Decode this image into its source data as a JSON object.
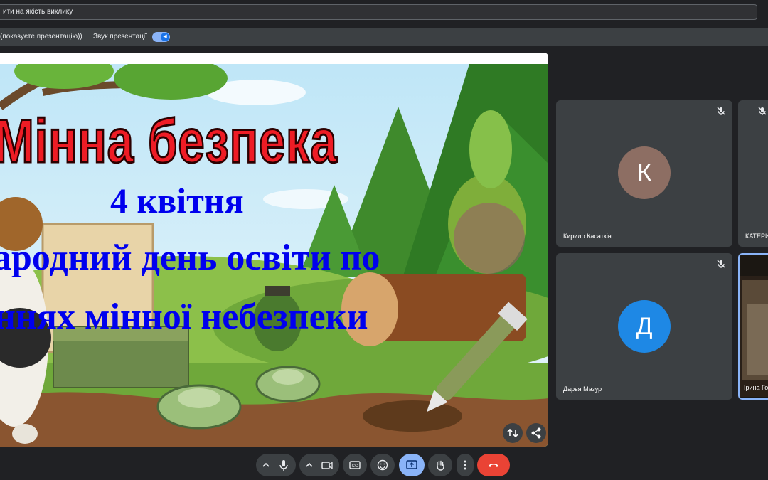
{
  "topbar": {
    "feedback_text": "ити на якість виклику"
  },
  "presentation_bar": {
    "status_text": "(показуєте презентацію))",
    "sound_label": "Звук презентації",
    "sound_on": true
  },
  "slide": {
    "title": "Мінна безпека",
    "date": "4 квітня",
    "line1": "народний день освіти по",
    "line2": "аннях мінної небезпеки",
    "title_color": "#ee1c25",
    "text_color": "#0000ee"
  },
  "participants": [
    {
      "initial": "К",
      "name": "Кирило Касаткін",
      "avatar_color": "#8d6e63",
      "muted": true
    },
    {
      "initial": "",
      "name": "КАТЕРИ",
      "avatar_color": "",
      "muted": true
    },
    {
      "initial": "Д",
      "name": "Дарья Мазур",
      "avatar_color": "#1e88e5",
      "muted": true
    },
    {
      "initial": "",
      "name": "Ірина Го",
      "avatar_color": "",
      "muted": false
    }
  ],
  "controls": {
    "present_active_color": "#8ab4f8",
    "end_call_color": "#ea4335",
    "icons": [
      "chevron-up-icon",
      "mic-icon",
      "chevron-up-icon",
      "camera-icon",
      "captions-icon",
      "emoji-icon",
      "present-icon",
      "raise-hand-icon",
      "more-icon",
      "end-call-icon"
    ]
  }
}
